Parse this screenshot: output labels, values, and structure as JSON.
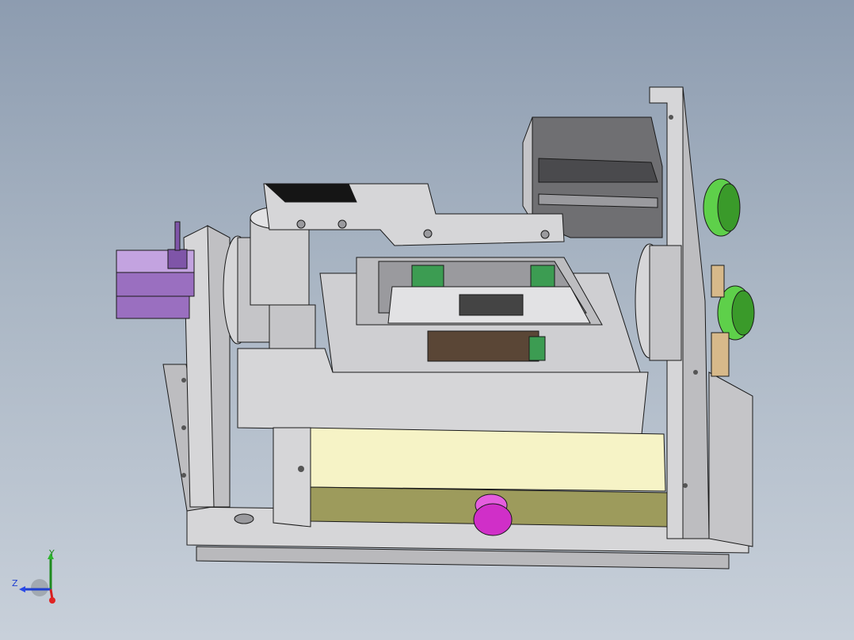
{
  "viewport": {
    "background_top": "#8d9cb0",
    "background_bottom": "#c8d0da"
  },
  "model": {
    "description_hidden": "",
    "colors": {
      "metal": "#d6d6d8",
      "metal_dark": "#9a9a9e",
      "edge": "#1a1a1a",
      "tray": "#f6f3c6",
      "tray_front": "#9d9b5c",
      "pulley": "#5ed04a",
      "connector": "#9a6fc0",
      "knob": "#d02fc8",
      "block_tan": "#d7b98a",
      "pcb": "#3c9c52",
      "motor": "#6f6f72",
      "arm_black": "#151515"
    }
  },
  "triad": {
    "y_label": "Y",
    "z_label": "Z",
    "y_color": "#1e8a1e",
    "z_color": "#1f3fd0",
    "x_color": "#d61f1f"
  }
}
